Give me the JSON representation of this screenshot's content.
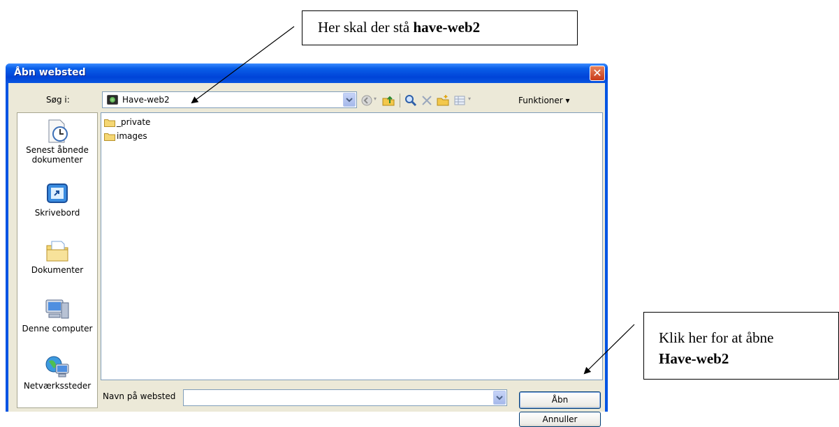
{
  "callouts": {
    "top": {
      "prefix": "Her skal der stå ",
      "bold": "have-web2"
    },
    "right": {
      "line1": "Klik her for at åbne",
      "bold": "Have-web2"
    }
  },
  "dialog": {
    "title": "Åbn websted",
    "close_symbol": "✕",
    "look_in_label": "Søg i:",
    "look_in_value": "Have-web2",
    "tools_label": "Funktioner ▾",
    "places": [
      {
        "label_line1": "Senest åbnede",
        "label_line2": "dokumenter",
        "icon": "recent-documents-icon"
      },
      {
        "label_line1": "Skrivebord",
        "icon": "desktop-icon"
      },
      {
        "label_line1": "Dokumenter",
        "icon": "documents-folder-icon"
      },
      {
        "label_line1": "Denne computer",
        "icon": "computer-icon"
      },
      {
        "label_line1": "Netværkssteder",
        "icon": "network-icon"
      }
    ],
    "files": [
      {
        "name": "_private",
        "icon": "folder-icon"
      },
      {
        "name": "images",
        "icon": "folder-icon"
      }
    ],
    "name_label": "Navn på websted",
    "name_value": "",
    "open_button": "Åbn",
    "cancel_button": "Annuller"
  },
  "colors": {
    "titlebar": "#0054e3",
    "dialog_bg": "#ece9d8",
    "close_button": "#d9572f"
  }
}
